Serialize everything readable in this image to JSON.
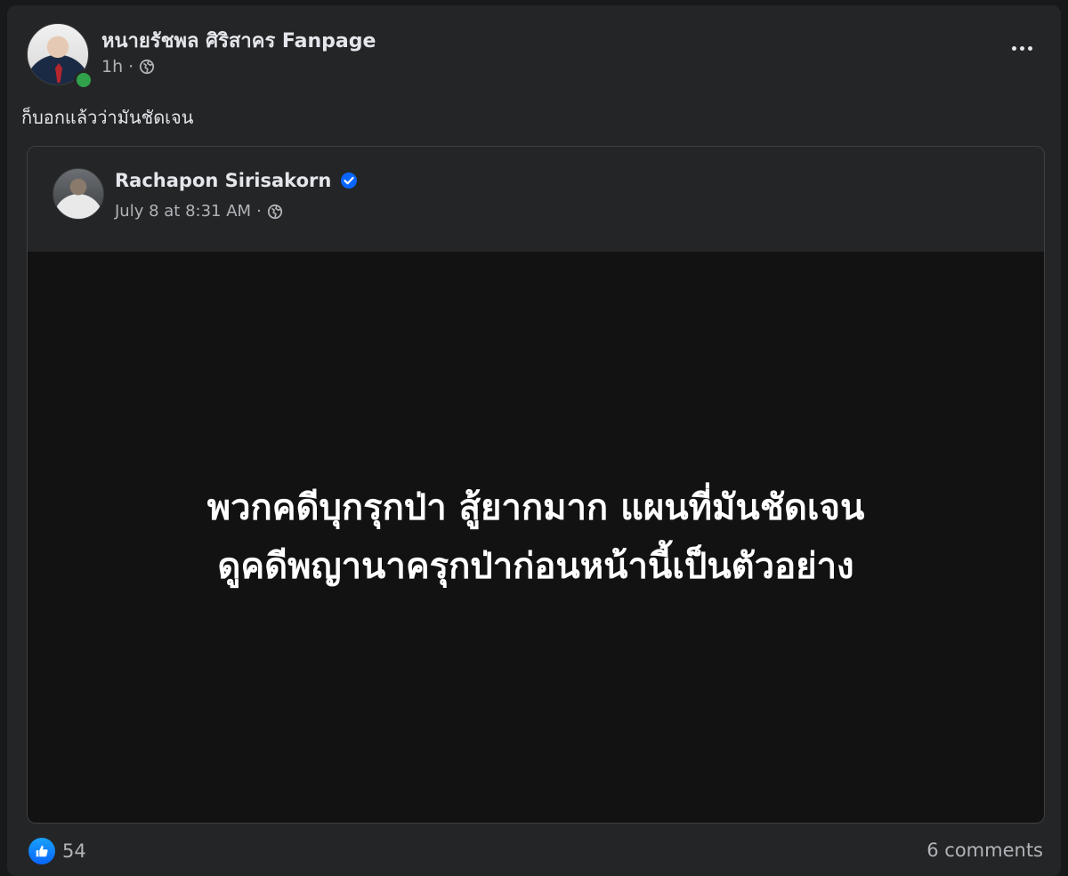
{
  "post": {
    "author": "หนายรัชพล ศิริสาคร Fanpage",
    "time": "1h",
    "separator": "·",
    "audience_icon": "globe-icon",
    "more_icon": "more-options-icon",
    "text": "ก็บอกแล้วว่ามันชัดเจน"
  },
  "shared_post": {
    "author": "Rachapon Sirisakorn",
    "verified_icon": "verified-badge-icon",
    "time": "July 8 at 8:31 AM",
    "separator": "·",
    "audience_icon": "globe-icon",
    "media_lines": [
      "พวกคดีบุกรุกป่า สู้ยากมาก แผนที่มันชัดเจน",
      "ดูคดีพญานาครุกป่าก่อนหน้านี้เป็นตัวอย่าง"
    ]
  },
  "footer": {
    "reaction_icon": "like-icon",
    "reaction_count": "54",
    "comments": "6 comments"
  },
  "colors": {
    "background": "#18191a",
    "card": "#242526",
    "media": "#121212",
    "accent": "#0866ff",
    "online": "#31a24c"
  }
}
